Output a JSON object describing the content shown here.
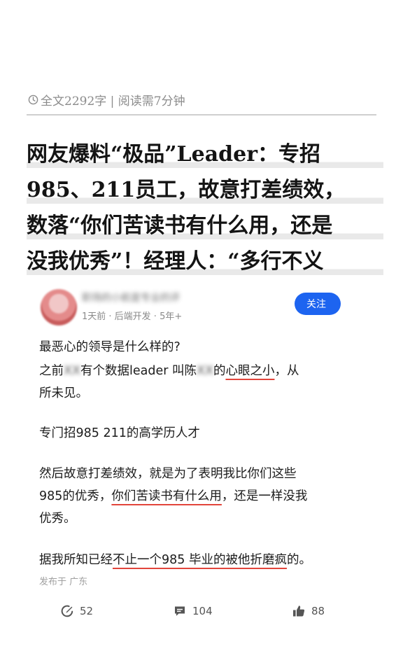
{
  "article": {
    "meta": "全文2292字 | 阅读需7分钟",
    "headline_lines": [
      "网友爆料“极品”Leader：专招",
      "985、211员工，故意打差绩效，",
      "数落“你们苦读书有什么用，还是",
      "没我优秀”！经理人：“多行不义"
    ]
  },
  "post": {
    "author": {
      "name": "职场的小航是专业的评",
      "subline": "1天前 · 后端开发 · 5年+"
    },
    "follow_label": "关注",
    "question": "最恶心的领导是什么样的?",
    "para1": {
      "a": "之前",
      "b": "XX",
      "c": "有个数据leader 叫陈",
      "d": "XX",
      "e": "的",
      "f": "心眼之小",
      "g": "，从",
      "line2": "所未见。"
    },
    "para2": "专门招985  211的高学历人才",
    "para3": {
      "line1": "然后故意打差绩效，就是为了表明我比你们这些",
      "line2a": "985的优秀，",
      "line2b": "你们苦读书有什么用",
      "line2c": "，还是一样没我",
      "line3": "优秀。"
    },
    "para4": {
      "a": "据我所知已经",
      "b": "不止一个985 毕业的被他折磨疯",
      "c": "的。"
    },
    "location": "发布于 广东",
    "stats": {
      "likes_label": "52",
      "comments_label": "104",
      "thumbs_label": "88"
    }
  },
  "colors": {
    "accent_blue": "#1d64f0",
    "underline_red": "#e2453b"
  },
  "icons": [
    "clock-icon",
    "edit-icon",
    "comment-icon",
    "thumbs-up-icon"
  ]
}
